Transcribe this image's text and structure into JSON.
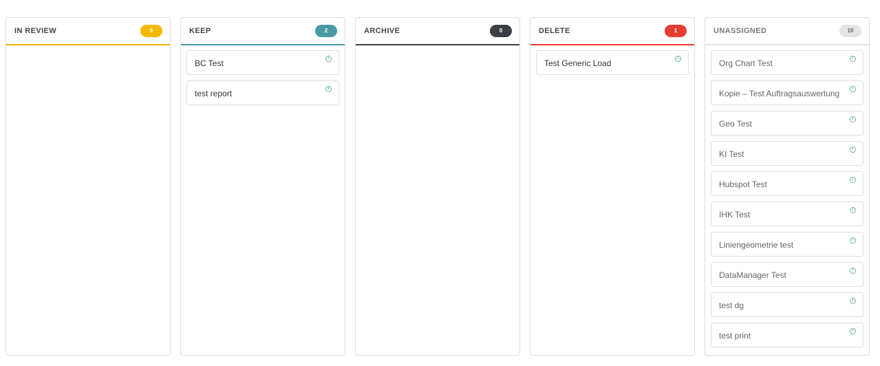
{
  "columns": [
    {
      "title": "IN REVIEW",
      "count": "0",
      "accent_color": "#f5b800",
      "badge_text_color": "#ffffff",
      "cards": []
    },
    {
      "title": "KEEP",
      "count": "2",
      "accent_color": "#4a9aa5",
      "badge_text_color": "#ffffff",
      "cards": [
        {
          "label": "BC Test",
          "icon": "info-icon"
        },
        {
          "label": "test report",
          "icon": "info-icon"
        }
      ]
    },
    {
      "title": "ARCHIVE",
      "count": "0",
      "accent_color": "#3b3f44",
      "badge_text_color": "#ffffff",
      "cards": []
    },
    {
      "title": "DELETE",
      "count": "1",
      "accent_color": "#e53d2f",
      "badge_text_color": "#ffffff",
      "cards": [
        {
          "label": "Test Generic Load",
          "icon": "info-icon"
        }
      ]
    },
    {
      "title": "UNASSIGNED",
      "count": "10",
      "accent_color": "#e4e4e4",
      "badge_text_color": "#666666",
      "muted": true,
      "cards": [
        {
          "label": "Org Chart Test",
          "icon": "info-icon"
        },
        {
          "label": "Kopie – Test Auftragsauswertung",
          "icon": "info-icon"
        },
        {
          "label": "Geo Test",
          "icon": "info-icon"
        },
        {
          "label": "KI Test",
          "icon": "info-icon"
        },
        {
          "label": "Hubspot Test",
          "icon": "info-icon"
        },
        {
          "label": "IHK Test",
          "icon": "info-icon"
        },
        {
          "label": "Liniengeometrie test",
          "icon": "info-icon"
        },
        {
          "label": "DataManager Test",
          "icon": "info-icon"
        },
        {
          "label": "test dg",
          "icon": "info-icon"
        },
        {
          "label": "test print",
          "icon": "info-icon"
        }
      ]
    }
  ]
}
